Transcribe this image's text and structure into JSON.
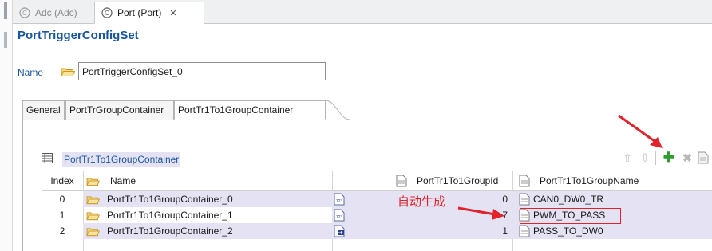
{
  "editor_tabs": [
    {
      "label": "Adc (Adc)",
      "active": false
    },
    {
      "label": "Port (Port)",
      "active": true
    }
  ],
  "page_title": "PortTriggerConfigSet",
  "name_field": {
    "label": "Name",
    "value": "PortTriggerConfigSet_0"
  },
  "form_tabs": [
    "General",
    "PortTrGroupContainer",
    "PortTr1To1GroupContainer"
  ],
  "section_title": "PortTr1To1GroupContainer",
  "table": {
    "columns": [
      "Index",
      "Name",
      "PortTr1To1GroupId",
      "PortTr1To1GroupName"
    ],
    "rows": [
      {
        "index": "0",
        "name": "PortTr1To1GroupContainer_0",
        "id": "0",
        "group_name": "CAN0_DW0_TR"
      },
      {
        "index": "1",
        "name": "PortTr1To1GroupContainer_1",
        "id": "7",
        "group_name": "PWM_TO_PASS"
      },
      {
        "index": "2",
        "name": "PortTr1To1GroupContainer_2",
        "id": "1",
        "group_name": "PASS_TO_DW0"
      }
    ]
  },
  "annotation": {
    "text": "自动生成",
    "color": "#e0222a"
  },
  "colors": {
    "title": "#19559c",
    "row_highlight": "#e5e3f3",
    "annotation": "#e0222a",
    "add": "#2e9c2e"
  },
  "icons": [
    "component-icon",
    "close-icon",
    "folder-icon",
    "table-icon",
    "move-up-icon",
    "move-down-icon",
    "add-icon",
    "delete-icon",
    "document-icon",
    "numeric-icon",
    "linked-icon"
  ]
}
